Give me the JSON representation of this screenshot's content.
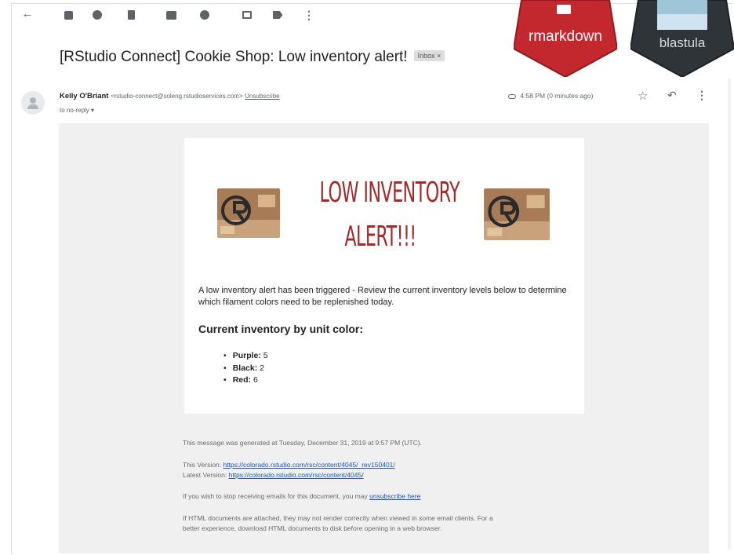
{
  "toolbar": {
    "icons": [
      "back-arrow-icon",
      "archive-icon",
      "report-spam-icon",
      "delete-icon",
      "mark-unread-icon",
      "snooze-icon",
      "move-to-icon",
      "labels-icon",
      "more-vert-icon"
    ]
  },
  "badges": {
    "rmarkdown": "rmarkdown",
    "blastula": "blastula",
    "rmarkdown_color": "#c3282e",
    "blastula_color": "#2f3438"
  },
  "email": {
    "subject": "[RStudio Connect] Cookie Shop: Low inventory alert!",
    "inbox_label": "Inbox ×",
    "sender_name": "Kelly O'Briant",
    "sender_address": "<rstudio-connect@soleng.rstudioservices.com>",
    "unsubscribe_link": "Unsubscribe",
    "to_line": "to no-reply ▾",
    "timestamp": "4:58 PM (0 minutes ago)"
  },
  "card": {
    "title_line1": "LOW INVENTORY",
    "title_line2": "ALERT!!!",
    "title_color": "#a32a2a",
    "intro": "A low inventory alert has been triggered - Review the current inventory levels below to determine which filament colors need to be replenished today.",
    "heading": "Current inventory by unit color:",
    "items": [
      {
        "label": "Purple:",
        "value": "5"
      },
      {
        "label": "Black:",
        "value": "2"
      },
      {
        "label": "Red:",
        "value": "6"
      }
    ]
  },
  "footer": {
    "generated": "This message was generated at Tuesday, December 31, 2019 at 9:57 PM (UTC).",
    "this_version_label": "This Version:",
    "this_version_url": "https://colorado.rstudio.com/rsc/content/4045/_rev150401/",
    "latest_version_label": "Latest Version:",
    "latest_version_url": "https://colorado.rstudio.com/rsc/content/4045/",
    "stop_text": "If you wish to stop receiving emails for this document, you may",
    "unsubscribe_here": "unsubscribe here",
    "html_note_line1": "If HTML documents are attached, they may not render correctly when viewed in some email clients. For a",
    "html_note_line2": "better experience, download HTML documents to disk before opening in a web browser."
  }
}
